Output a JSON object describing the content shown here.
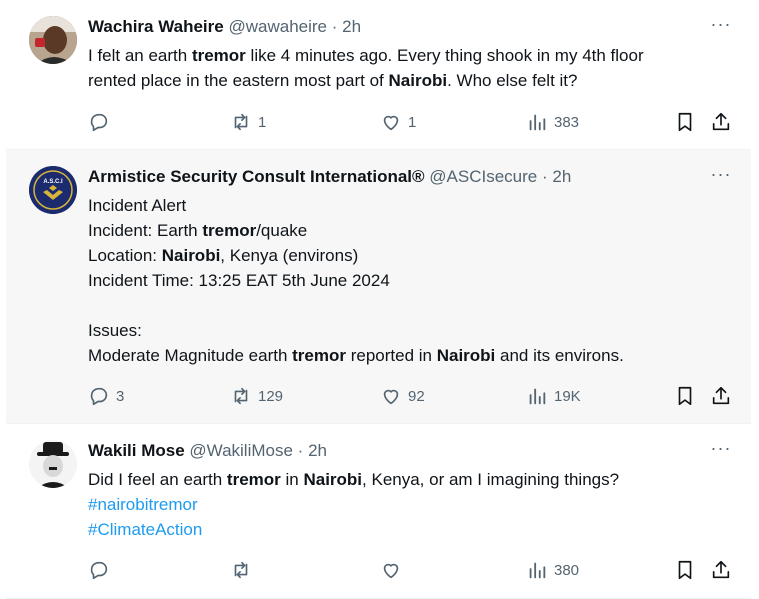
{
  "tweets": [
    {
      "author": "Wachira Waheire",
      "handle": "@wawaheire",
      "sep": "·",
      "time": "2h",
      "more": "···",
      "lines": [
        [
          {
            "t": "I felt an earth "
          },
          {
            "t": "tremor",
            "b": true
          },
          {
            "t": " like 4 minutes ago. Every thing shook in my 4th floor"
          }
        ],
        [
          {
            "t": "rented place in the eastern most part of "
          },
          {
            "t": "Nairobi",
            "b": true
          },
          {
            "t": ". Who else felt it?"
          }
        ]
      ],
      "replies": "",
      "reposts": "1",
      "likes": "1",
      "views": "383"
    },
    {
      "author": "Armistice Security Consult International®",
      "handle": "@ASCIsecure",
      "sep": "·",
      "time": "2h",
      "more": "···",
      "logo_text": "A.S.C.I",
      "lines": [
        [
          {
            "t": "Incident Alert"
          }
        ],
        [
          {
            "t": "Incident: Earth "
          },
          {
            "t": "tremor",
            "b": true
          },
          {
            "t": "/quake"
          }
        ],
        [
          {
            "t": "Location: "
          },
          {
            "t": "Nairobi",
            "b": true
          },
          {
            "t": ", Kenya (environs)"
          }
        ],
        [
          {
            "t": "Incident Time: 13:25 EAT  5th June 2024"
          }
        ],
        [],
        [
          {
            "t": "Issues:"
          }
        ],
        [
          {
            "t": "Moderate Magnitude earth "
          },
          {
            "t": "tremor",
            "b": true
          },
          {
            "t": " reported in "
          },
          {
            "t": "Nairobi",
            "b": true
          },
          {
            "t": " and its environs."
          }
        ]
      ],
      "replies": "3",
      "reposts": "129",
      "likes": "92",
      "views": "19K"
    },
    {
      "author": "Wakili Mose",
      "handle": "@WakiliMose",
      "sep": "·",
      "time": "2h",
      "more": "···",
      "lines": [
        [
          {
            "t": "Did I feel an earth "
          },
          {
            "t": "tremor",
            "b": true
          },
          {
            "t": " in "
          },
          {
            "t": "Nairobi",
            "b": true
          },
          {
            "t": ", Kenya, or am I imagining things?"
          }
        ],
        [
          {
            "t": "#nairobitremor",
            "tag": true
          }
        ],
        [
          {
            "t": "#ClimateAction",
            "tag": true
          }
        ]
      ],
      "replies": "",
      "reposts": "",
      "likes": "",
      "views": "380"
    }
  ],
  "colors": {
    "text": "#0f1419",
    "muted": "#536471",
    "link": "#1d9bf0",
    "highlight_bg": "#f7f7f7",
    "divider": "#eff3f4"
  },
  "icons": [
    "reply-icon",
    "repost-icon",
    "like-icon",
    "views-icon",
    "bookmark-icon",
    "share-icon",
    "more-icon"
  ]
}
